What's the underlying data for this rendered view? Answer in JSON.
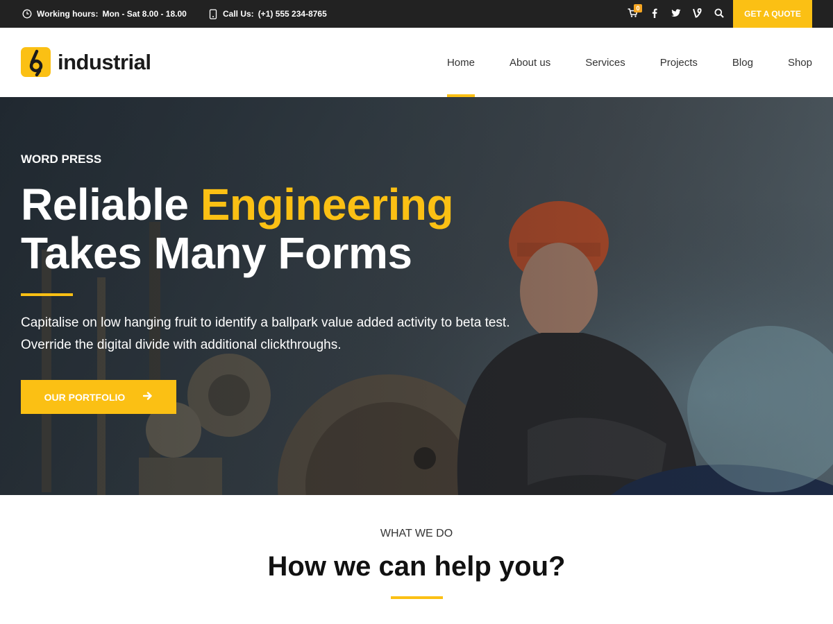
{
  "topbar": {
    "hours_label": "Working hours:",
    "hours_value": "Mon - Sat 8.00 - 18.00",
    "phone_label": "Call Us:",
    "phone_value": "(+1) 555 234-8765",
    "cart_count": "0",
    "icons": [
      "clock-icon",
      "phone-icon",
      "cart-icon",
      "facebook-icon",
      "twitter-icon",
      "vine-icon",
      "search-icon"
    ],
    "quote_label": "GET A QUOTE"
  },
  "header": {
    "logo_text": "industrial",
    "nav": [
      {
        "label": "Home",
        "active": true
      },
      {
        "label": "About us"
      },
      {
        "label": "Services"
      },
      {
        "label": "Projects"
      },
      {
        "label": "Blog"
      },
      {
        "label": "Shop"
      }
    ]
  },
  "hero": {
    "eyebrow": "WORD PRESS",
    "title_line1_part1": "Reliable ",
    "title_line1_accent": "Engineering",
    "title_line2": "Takes Many Forms",
    "description": "Capitalise on low hanging fruit to identify a ballpark value added activity to beta test. Override the digital divide with additional clickthroughs.",
    "button_label": "OUR PORTFOLIO"
  },
  "services": {
    "eyebrow": "WHAT WE DO",
    "title": "How we can help you?"
  },
  "colors": {
    "accent": "#fbc014",
    "topbar_bg": "#222222",
    "text_dark": "#1b1b1b"
  }
}
